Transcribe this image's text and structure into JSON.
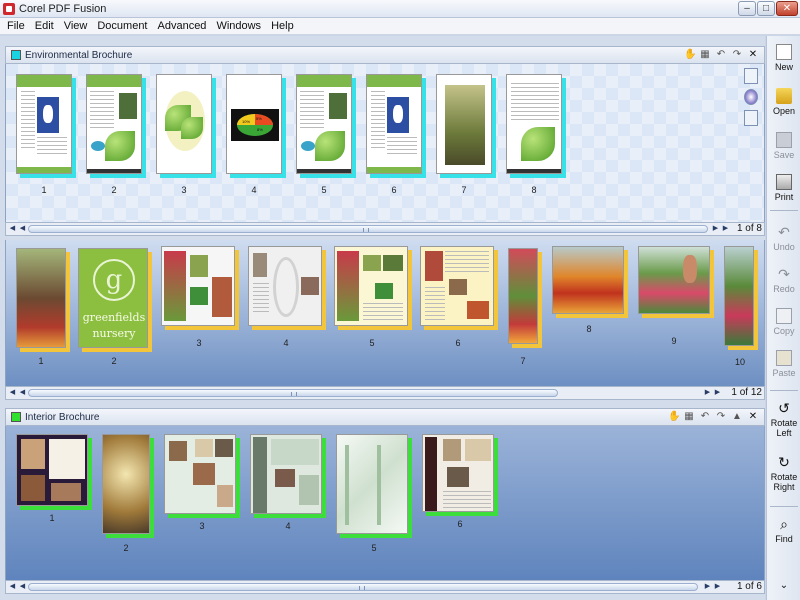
{
  "window": {
    "title": "Corel PDF Fusion",
    "min_label": "–",
    "max_label": "□",
    "close_label": "✕"
  },
  "menu": [
    "File",
    "Edit",
    "View",
    "Document",
    "Advanced",
    "Windows",
    "Help"
  ],
  "panels": [
    {
      "title": "Environmental Brochure",
      "swatch_color": "#19d3e0",
      "page_count": "1 of 8",
      "page_numbers": [
        "1",
        "2",
        "3",
        "4",
        "5",
        "6",
        "7",
        "8"
      ],
      "thumb_chart_labels": [
        "5%",
        "10%",
        "8%"
      ]
    },
    {
      "title": "",
      "page_count": "1 of 12",
      "page_numbers": [
        "1",
        "2",
        "3",
        "4",
        "5",
        "6",
        "7",
        "8",
        "9",
        "10"
      ],
      "logo_letter": "g",
      "logo_line1": "greenfields",
      "logo_line2": "nursery"
    },
    {
      "title": "Interior Brochure",
      "swatch_color": "#2fe02f",
      "page_count": "1 of 6",
      "page_numbers": [
        "1",
        "2",
        "3",
        "4",
        "5",
        "6"
      ]
    }
  ],
  "header_icons": [
    "hand-icon",
    "page-layout-icon",
    "rotate-left-icon",
    "rotate-right-icon",
    "close-icon"
  ],
  "sidebar": {
    "new": "New",
    "open": "Open",
    "save": "Save",
    "print": "Print",
    "undo": "Undo",
    "redo": "Redo",
    "copy": "Copy",
    "paste": "Paste",
    "rotate_left_1": "Rotate",
    "rotate_left_2": "Left",
    "rotate_right_1": "Rotate",
    "rotate_right_2": "Right",
    "find": "Find"
  }
}
